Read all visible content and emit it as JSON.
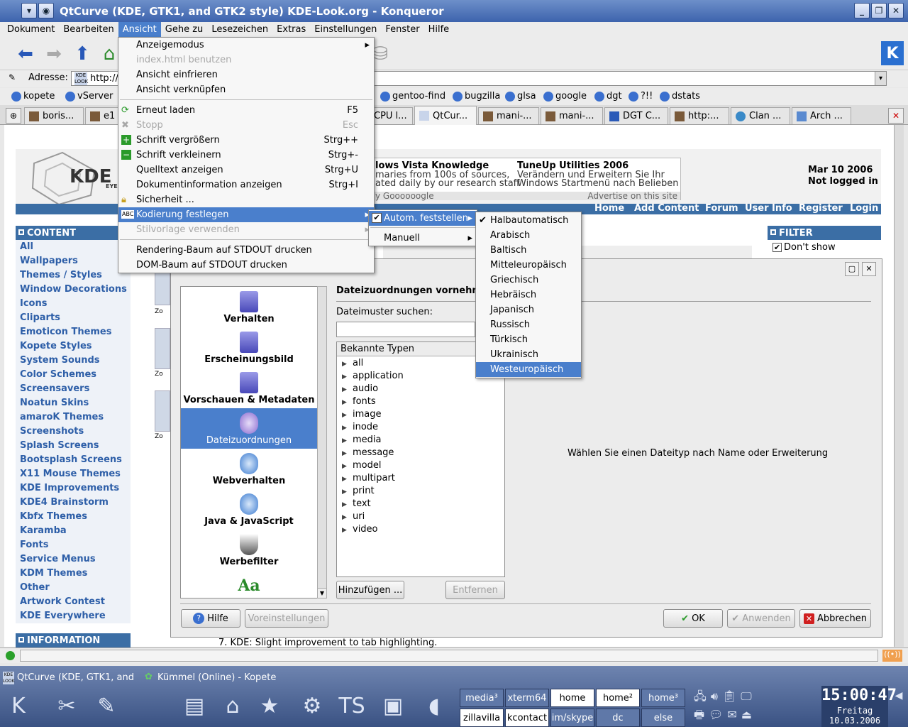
{
  "window": {
    "title": "QtCurve (KDE, GTK1, and GTK2 style) KDE-Look.org - Konqueror"
  },
  "menubar": [
    "Dokument",
    "Bearbeiten",
    "Ansicht",
    "Gehe zu",
    "Lesezeichen",
    "Extras",
    "Einstellungen",
    "Fenster",
    "Hilfe"
  ],
  "address": {
    "label": "Adresse:",
    "value": "http://"
  },
  "bookmarks": [
    "kopete",
    "vServer",
    "gentoo-find",
    "bugzilla",
    "glsa",
    "google",
    "dgt",
    "?!!",
    "dstats"
  ],
  "tabs": [
    "boris...",
    "e1",
    "CPU l...",
    "QtCur...",
    "mani-...",
    "mani-...",
    "DGT C...",
    "http:...",
    "Clan ...",
    "Arch ..."
  ],
  "page": {
    "ad_title_1": "lows Vista Knowledge",
    "ad_text_1a": "maries from 100s of sources,",
    "ad_text_1b": "ated daily by our research staff",
    "ad_title_2": "TuneUp Utilities 2006",
    "ad_text_2a": "Verändern und Erweitern Sie Ihr",
    "ad_text_2b": "Windows Startmenü nach Belieben",
    "ad_footer_1": "y Goooooogle",
    "ad_footer_2": "Advertise on this site",
    "date": "Mar 10 2006",
    "login_status": "Not logged in",
    "logo_text": "KDE",
    "logo_sub": "EYE",
    "nav": [
      "Home",
      "Add Content",
      "Forum",
      "User Info",
      "Register",
      "Login"
    ],
    "content_heading": "CONTENT",
    "content_items": [
      "All",
      "Wallpapers",
      "Themes / Styles",
      "Window Decorations",
      "Icons",
      "Cliparts",
      "Emoticon Themes",
      "Kopete Styles",
      "System Sounds",
      "Color Schemes",
      "Screensavers",
      "Noatun Skins",
      "amaroK Themes",
      "Screenshots",
      "Splash Screens",
      "Bootsplash Screens",
      "X11 Mouse Themes",
      "KDE Improvements",
      "KDE4 Brainstorm",
      "Kbfx Themes",
      "Karamba",
      "Fonts",
      "Service Menus",
      "KDM Themes",
      "Other",
      "Artwork Contest",
      "KDE Everywhere"
    ],
    "info_heading": "INFORMATION",
    "filter_heading": "FILTER",
    "filter_option": "Don't show",
    "thumb_zoom": "Zo",
    "body_text": "7. KDE: Slight improvement to tab highlighting."
  },
  "dialog": {
    "sections": [
      "Verhalten",
      "Erscheinungsbild",
      "Vorschauen & Metadaten",
      "Dateizuordnungen",
      "Webverhalten",
      "Java & JavaScript",
      "Werbefilter"
    ],
    "selected_section": "Dateizuordnungen",
    "heading": "Dateizuordnungen vornehm",
    "search_label": "Dateimuster suchen:",
    "types_header": "Bekannte Typen",
    "types": [
      "all",
      "application",
      "audio",
      "fonts",
      "image",
      "inode",
      "media",
      "message",
      "model",
      "multipart",
      "print",
      "text",
      "uri",
      "video"
    ],
    "placeholder_text": "Wählen Sie einen Dateityp nach Name oder Erweiterung",
    "add_btn": "Hinzufügen ...",
    "remove_btn": "Entfernen",
    "help_btn": "Hilfe",
    "defaults_btn": "Voreinstellungen",
    "ok_btn": "OK",
    "apply_btn": "Anwenden",
    "cancel_btn": "Abbrechen"
  },
  "ansicht_menu": [
    {
      "label": "Anzeigemodus",
      "shortcut": "",
      "sub": true,
      "disabled": false
    },
    {
      "label": "index.html benutzen",
      "shortcut": "",
      "sub": false,
      "disabled": true
    },
    {
      "label": "Ansicht einfrieren",
      "shortcut": "",
      "sub": false,
      "disabled": false
    },
    {
      "label": "Ansicht verknüpfen",
      "shortcut": "",
      "sub": false,
      "disabled": false
    },
    {
      "label": "Erneut laden",
      "shortcut": "F5",
      "sub": false,
      "disabled": false
    },
    {
      "label": "Stopp",
      "shortcut": "Esc",
      "sub": false,
      "disabled": true
    },
    {
      "label": "Schrift vergrößern",
      "shortcut": "Strg++",
      "sub": false,
      "disabled": false
    },
    {
      "label": "Schrift verkleinern",
      "shortcut": "Strg+-",
      "sub": false,
      "disabled": false
    },
    {
      "label": "Quelltext anzeigen",
      "shortcut": "Strg+U",
      "sub": false,
      "disabled": false
    },
    {
      "label": "Dokumentinformation anzeigen",
      "shortcut": "Strg+I",
      "sub": false,
      "disabled": false
    },
    {
      "label": "Sicherheit ...",
      "shortcut": "",
      "sub": false,
      "disabled": false
    },
    {
      "label": "Kodierung festlegen",
      "shortcut": "",
      "sub": true,
      "disabled": false
    },
    {
      "label": "Stilvorlage verwenden",
      "shortcut": "",
      "sub": true,
      "disabled": true
    },
    {
      "label": "Rendering-Baum auf STDOUT drucken",
      "shortcut": "",
      "sub": false,
      "disabled": false
    },
    {
      "label": "DOM-Baum auf STDOUT drucken",
      "shortcut": "",
      "sub": false,
      "disabled": false
    }
  ],
  "encoding_menu": [
    "Autom. feststellen",
    "Manuell"
  ],
  "auto_menu": [
    "Halbautomatisch",
    "Arabisch",
    "Baltisch",
    "Mitteleuropäisch",
    "Griechisch",
    "Hebräisch",
    "Japanisch",
    "Russisch",
    "Türkisch",
    "Ukrainisch",
    "Westeuropäisch"
  ],
  "taskbar": {
    "task_1": "QtCurve (KDE, GTK1, and",
    "task_2": "Kümmel (Online) - Kopete",
    "pager": [
      "media³",
      "xterm64",
      "home",
      "home²",
      "home³",
      "zillavilla",
      "kcontact",
      "im/skype",
      "dc",
      "else"
    ],
    "clock_time": "15:00:47",
    "clock_day": "Freitag",
    "clock_date": "10.03.2006"
  }
}
